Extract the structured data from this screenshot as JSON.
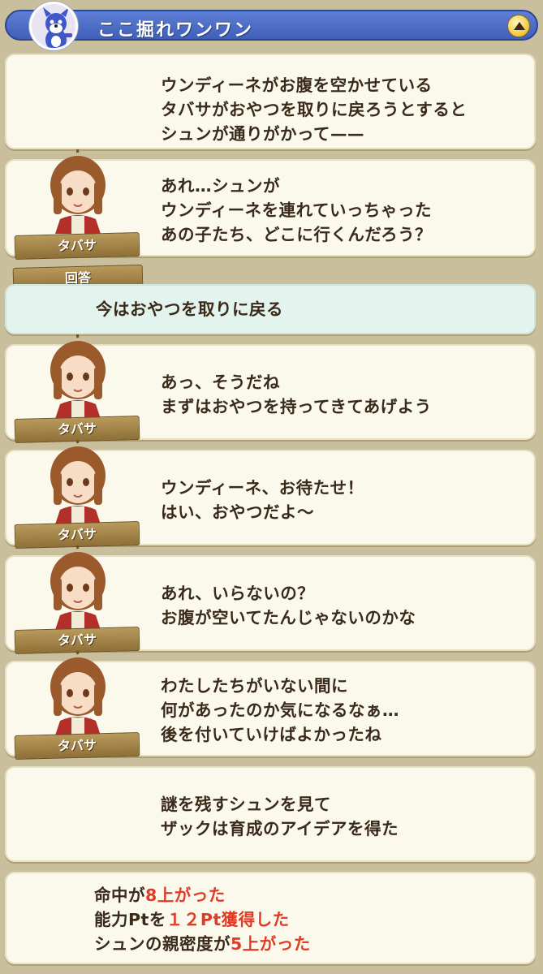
{
  "header": {
    "title": "ここ掘れワンワン",
    "avatar_icon": "blue-dog-mascot-icon",
    "collapse_icon": "triangle-up-icon"
  },
  "speaker_name": "タバサ",
  "answer_label": "回答",
  "messages": [
    {
      "lines": [
        "ウンディーネがお腹を空かせている",
        "タバサがおやつを取りに戻ろうとすると",
        "シュンが通りがかって——"
      ]
    },
    {
      "lines": [
        "あれ…シュンが",
        "ウンディーネを連れていっちゃった",
        "あの子たち、どこに行くんだろう？"
      ]
    },
    {
      "answer": "今はおやつを取りに戻る"
    },
    {
      "lines": [
        "あっ、そうだね",
        "まずはおやつを持ってきてあげよう"
      ]
    },
    {
      "lines": [
        "ウンディーネ、お待たせ！",
        "はい、おやつだよ〜"
      ]
    },
    {
      "lines": [
        "あれ、いらないの？",
        "お腹が空いてたんじゃないのかな"
      ]
    },
    {
      "lines": [
        "わたしたちがいない間に",
        "何があったのか気になるなぁ…",
        "後を付いていけばよかったね"
      ]
    },
    {
      "lines": [
        "謎を残すシュンを見て",
        "ザックは育成のアイデアを得た"
      ]
    }
  ],
  "results": [
    {
      "pre": "命中が",
      "value": "8",
      "post": "上がった"
    },
    {
      "pre": "能力Ptを",
      "value": "１２Pt",
      "post": "獲得した"
    },
    {
      "pre": "シュンの親密度が",
      "value": "5",
      "post": "上がった"
    }
  ],
  "colors": {
    "highlight": "#e03b26",
    "header": "#4a6cc8",
    "card": "#fbf9ec",
    "answer_card": "#e3f3ee"
  }
}
